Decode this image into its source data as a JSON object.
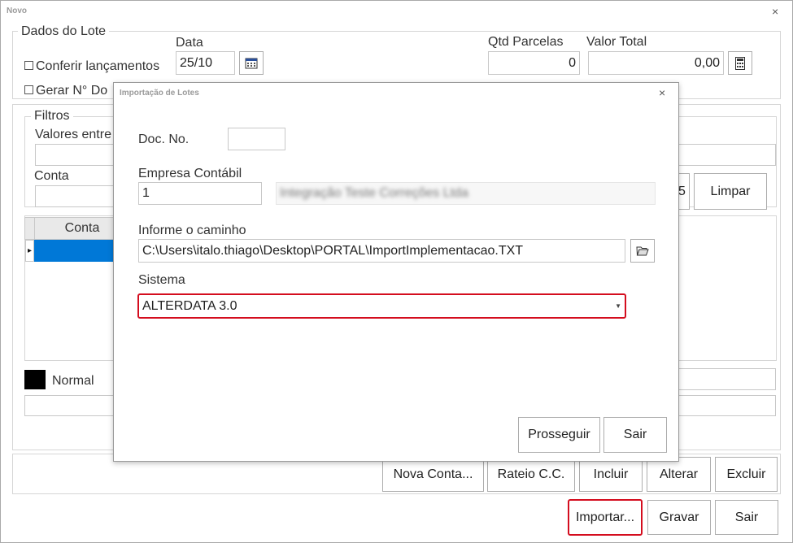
{
  "window": {
    "title": "Novo",
    "close": "×"
  },
  "lote": {
    "group_label": "Dados do Lote",
    "data_label": "Data",
    "data_value": "25/10",
    "conferir_label": "Conferir lançamentos",
    "gerar_label": "Gerar N° Do",
    "qtd_label": "Qtd Parcelas",
    "qtd_value": "0",
    "valor_label": "Valor Total",
    "valor_value": "0,00"
  },
  "filtros": {
    "group_label": "Filtros",
    "valores_label": "Valores entre",
    "conta_label": "Conta",
    "partial_button": "5",
    "limpar_button": "Limpar"
  },
  "grid": {
    "col_conta": "Conta",
    "row_marker": "▸"
  },
  "legend": {
    "normal_label": "Normal"
  },
  "action_buttons": {
    "nova_conta": "Nova Conta...",
    "rateio": "Rateio C.C.",
    "incluir": "Incluir",
    "alterar": "Alterar",
    "excluir": "Excluir"
  },
  "footer_buttons": {
    "importar": "Importar...",
    "gravar": "Gravar",
    "sair": "Sair"
  },
  "dialog": {
    "title": "Importação de Lotes",
    "close": "×",
    "doc_label": "Doc. No.",
    "doc_value": "",
    "empresa_label": "Empresa Contábil",
    "empresa_value": "1",
    "empresa_name": "Integração Teste Correções Ltda",
    "caminho_label": "Informe o caminho",
    "caminho_value": "C:\\Users\\italo.thiago\\Desktop\\PORTAL\\ImportImplementacao.TXT",
    "sistema_label": "Sistema",
    "sistema_value": "ALTERDATA 3.0",
    "prosseguir_button": "Prosseguir",
    "sair_button": "Sair"
  },
  "colors": {
    "highlight": "#d40d1e",
    "selected_row": "#0078d7"
  }
}
